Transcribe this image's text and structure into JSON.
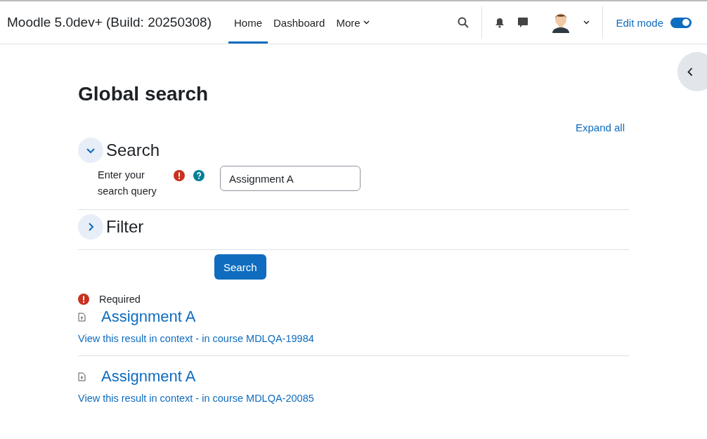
{
  "header": {
    "site_name": "Moodle 5.0dev+ (Build: 20250308)",
    "nav": [
      {
        "label": "Home",
        "selected": true
      },
      {
        "label": "Dashboard",
        "selected": false
      },
      {
        "label": "More",
        "selected": false
      }
    ],
    "edit_mode": {
      "label": "Edit mode",
      "on": true
    }
  },
  "page_title": "Global search",
  "expand_all": "Expand all",
  "sections": [
    {
      "title": "Search",
      "expanded": true
    },
    {
      "title": "Filter",
      "expanded": false
    }
  ],
  "query": {
    "label": "Enter your search query",
    "value": "Assignment A"
  },
  "search_button": "Search",
  "required_note": "Required",
  "results": [
    {
      "title": "Assignment A",
      "context_link": "View this result in context",
      "separator": "-",
      "course_link": "in course MDLQA-19984"
    },
    {
      "title": "Assignment A",
      "context_link": "View this result in context",
      "separator": "-",
      "course_link": "in course MDLQA-20085"
    }
  ]
}
